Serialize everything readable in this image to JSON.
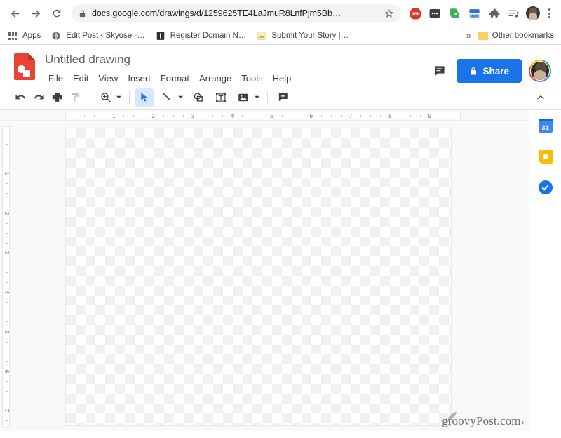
{
  "browser": {
    "nav": {
      "back_icon": "arrow-left-icon",
      "forward_icon": "arrow-right-icon",
      "reload_icon": "reload-icon"
    },
    "omnibox": {
      "lock_icon": "lock-icon",
      "url": "docs.google.com/drawings/d/1259625TE4LaJmuR8LnfPjm5Bb…",
      "star_icon": "star-icon"
    },
    "extensions": [
      {
        "name": "adblock-plus-icon",
        "label": "ABP"
      },
      {
        "name": "dark-reader-icon",
        "label": ""
      },
      {
        "name": "evernote-icon",
        "label": ""
      },
      {
        "name": "timer-extension-icon",
        "label": "35m"
      },
      {
        "name": "extensions-puzzle-icon",
        "label": ""
      },
      {
        "name": "reading-list-icon",
        "label": ""
      }
    ],
    "profile_avatar": "profile-avatar",
    "menu_icon": "chrome-menu-icon"
  },
  "bookmarks": {
    "apps_label": "Apps",
    "items": [
      {
        "label": "Edit Post ‹ Skyose -…",
        "icon": "globe-icon"
      },
      {
        "label": "Register Domain N…",
        "icon": "bookmark-blue-icon"
      },
      {
        "label": "Submit Your Story |…",
        "icon": "bookmark-yellow-icon"
      }
    ],
    "overflow_label": "»",
    "other_bookmarks_label": "Other bookmarks"
  },
  "app": {
    "logo_icon": "google-drawings-logo",
    "title": "Untitled drawing",
    "menus": [
      "File",
      "Edit",
      "View",
      "Insert",
      "Format",
      "Arrange",
      "Tools",
      "Help"
    ],
    "comment_icon": "comment-icon",
    "share_label": "Share",
    "share_lock_icon": "lock-icon",
    "share_color": "#1a73e8",
    "account_avatar": "account-avatar"
  },
  "toolbar": {
    "items": [
      {
        "name": "undo-button",
        "icon": "undo-icon",
        "caret": false,
        "active": false
      },
      {
        "name": "redo-button",
        "icon": "redo-icon",
        "caret": false,
        "active": false
      },
      {
        "name": "print-button",
        "icon": "print-icon",
        "caret": false,
        "active": false
      },
      {
        "name": "paint-format-button",
        "icon": "paint-format-icon",
        "caret": false,
        "active": false
      },
      {
        "name": "zoom-button",
        "icon": "zoom-icon",
        "caret": true,
        "active": false
      },
      {
        "name": "select-tool-button",
        "icon": "cursor-arrow-icon",
        "caret": false,
        "active": true
      },
      {
        "name": "line-tool-button",
        "icon": "line-icon",
        "caret": true,
        "active": false
      },
      {
        "name": "shape-tool-button",
        "icon": "shape-icon",
        "caret": false,
        "active": false
      },
      {
        "name": "text-box-button",
        "icon": "text-box-icon",
        "caret": false,
        "active": false
      },
      {
        "name": "image-button",
        "icon": "image-icon",
        "caret": true,
        "active": false
      },
      {
        "name": "add-comment-button",
        "icon": "add-comment-icon",
        "caret": false,
        "active": false
      }
    ],
    "collapse_icon": "chevron-up-icon"
  },
  "rulers": {
    "horizontal_labels": [
      "1",
      "2",
      "3",
      "4",
      "5",
      "6",
      "7",
      "8",
      "9"
    ],
    "vertical_labels": [
      "1",
      "2",
      "3",
      "4",
      "5",
      "6",
      "7"
    ],
    "unit": "inch"
  },
  "canvas": {
    "name": "drawing-canvas",
    "pattern": "transparency-checkerboard"
  },
  "right_rail": [
    {
      "name": "google-calendar-icon",
      "label": "31"
    },
    {
      "name": "google-keep-icon",
      "label": ""
    },
    {
      "name": "google-tasks-icon",
      "label": ""
    }
  ],
  "watermark": {
    "text": "groovyPost.com",
    "caret": "›",
    "icon": "quill-icon"
  }
}
